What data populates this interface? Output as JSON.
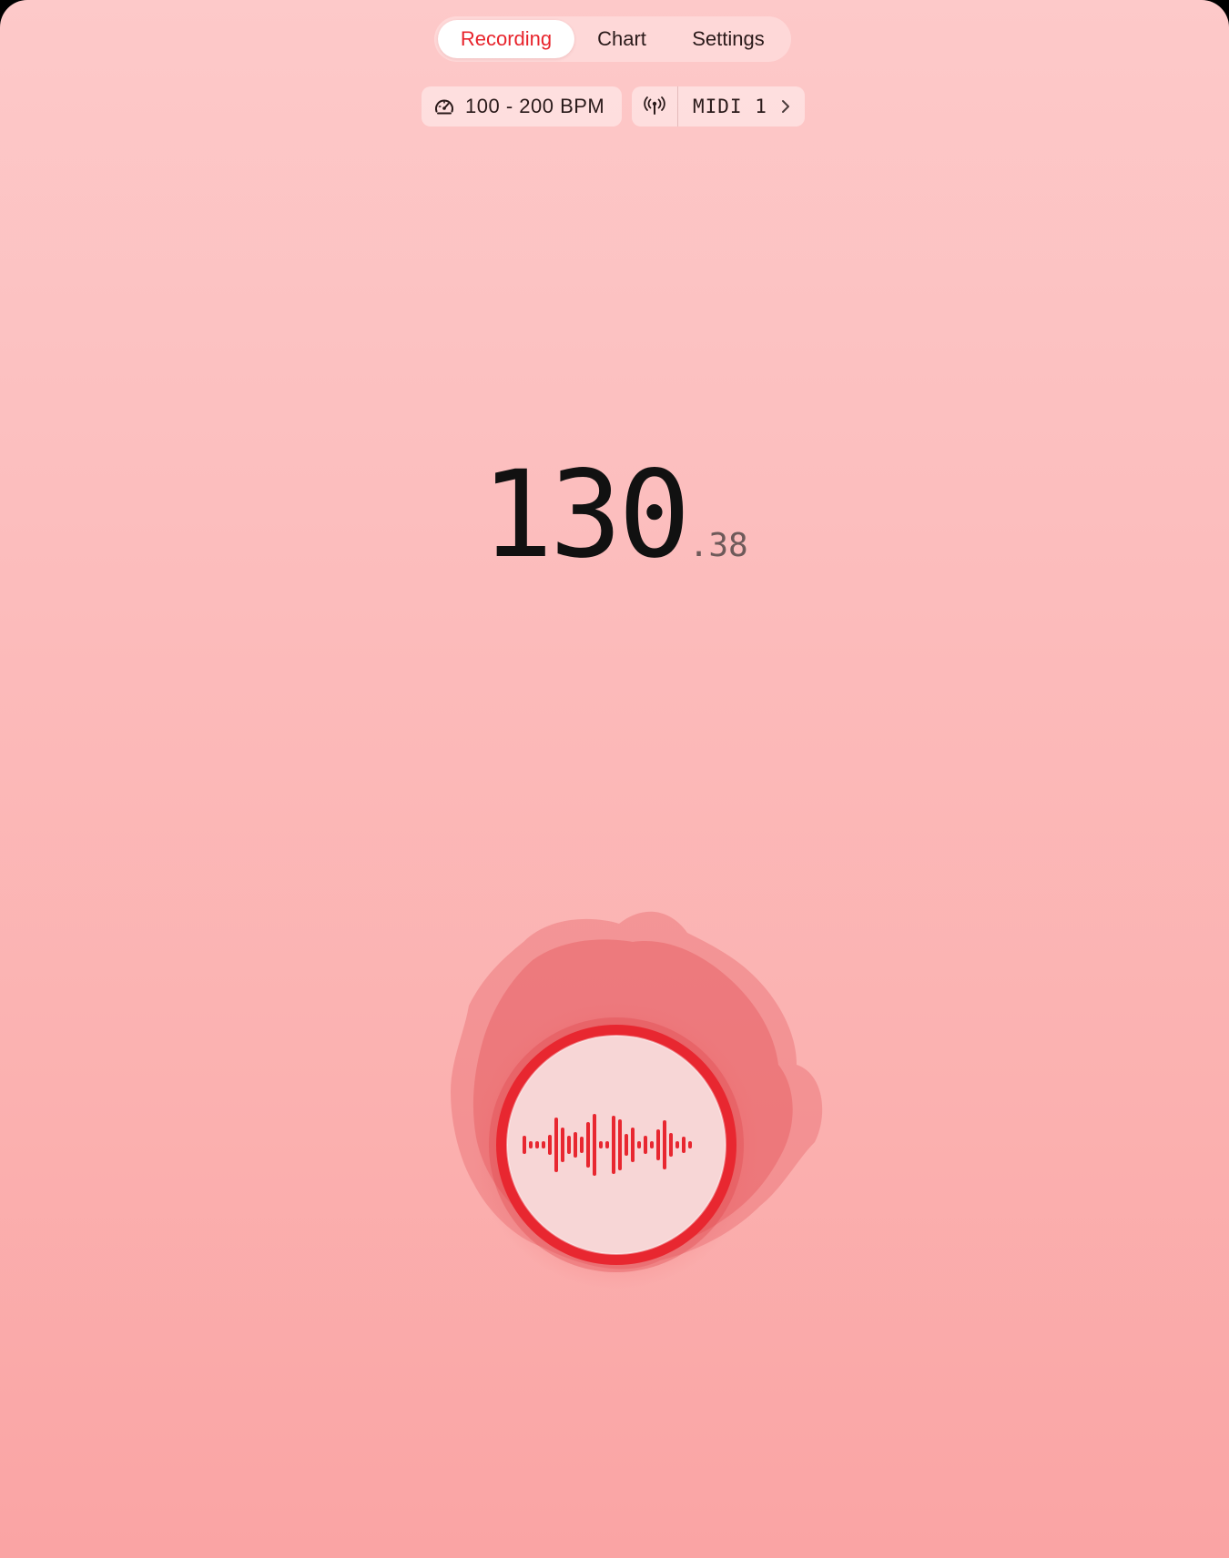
{
  "tabs": [
    {
      "label": "Recording",
      "active": true
    },
    {
      "label": "Chart",
      "active": false
    },
    {
      "label": "Settings",
      "active": false
    }
  ],
  "bpm_range": {
    "icon": "speedometer-icon",
    "label": "100 - 200 BPM"
  },
  "midi": {
    "icon": "antenna-icon",
    "label": "MIDI 1",
    "chevron_icon": "chevron-right-icon"
  },
  "tempo": {
    "whole": "130",
    "fraction": ".38"
  },
  "record_button": {
    "icon": "waveform-icon",
    "state": "recording"
  },
  "colors": {
    "accent": "#e8242c",
    "background_top": "#fdc9c9",
    "background_bottom": "#faa4a4"
  }
}
